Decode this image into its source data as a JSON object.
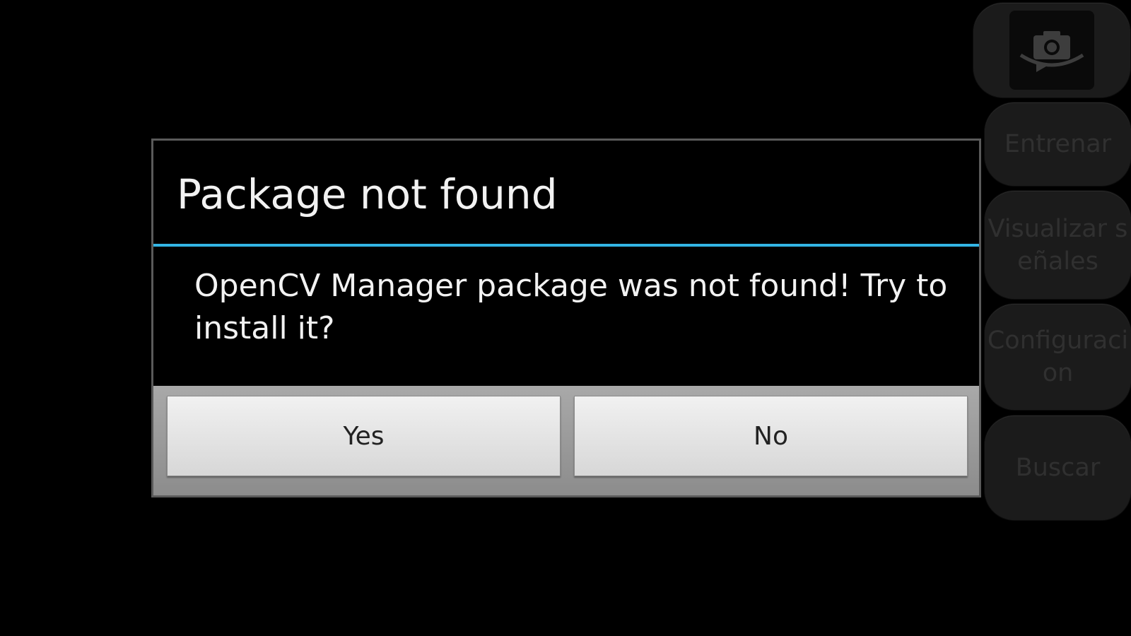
{
  "side_menu": {
    "camera_icon": "switch-camera-icon",
    "items": [
      {
        "label": "Entrenar"
      },
      {
        "label": "Visualizar señales"
      },
      {
        "label": "Configuracion"
      },
      {
        "label": "Buscar"
      }
    ]
  },
  "dialog": {
    "title": "Package not found",
    "message": "OpenCV Manager package was not found! Try to install it?",
    "yes_label": "Yes",
    "no_label": "No"
  },
  "colors": {
    "background": "#000000",
    "divider_accent": "#33b5e5",
    "button_bar": "#9a9a9a",
    "button_face": "#e4e4e4"
  }
}
